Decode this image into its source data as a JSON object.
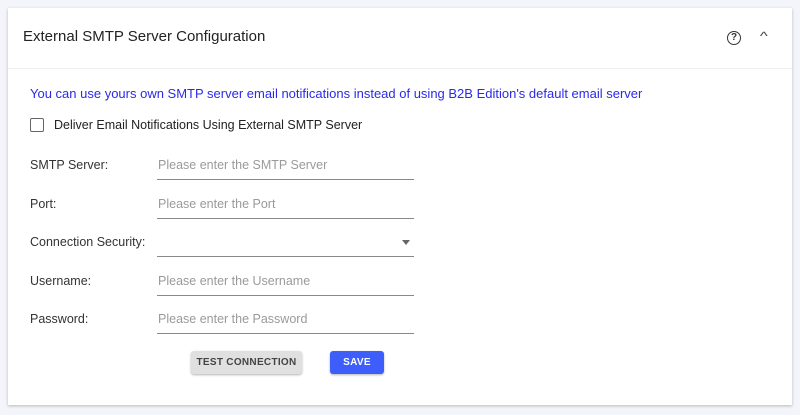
{
  "header": {
    "title": "External SMTP Server Configuration",
    "help_icon": "help-circle-icon",
    "collapse_icon": "chevron-up-icon"
  },
  "info_text": "You can use yours own SMTP server email notifications instead of using B2B Edition's default email server",
  "checkbox": {
    "label": "Deliver Email Notifications Using External SMTP Server",
    "checked": false
  },
  "fields": [
    {
      "label": "SMTP Server:",
      "placeholder": "Please enter the SMTP Server"
    },
    {
      "label": "Port:",
      "placeholder": "Please enter the Port"
    },
    {
      "label": "Connection Security:",
      "placeholder": ""
    },
    {
      "label": "Username:",
      "placeholder": "Please enter the Username"
    },
    {
      "label": "Password:",
      "placeholder": "Please enter the Password"
    }
  ],
  "buttons": {
    "test": "TEST CONNECTION",
    "save": "SAVE"
  },
  "colors": {
    "accent": "#3d5efb",
    "info": "#2a2ae8"
  }
}
